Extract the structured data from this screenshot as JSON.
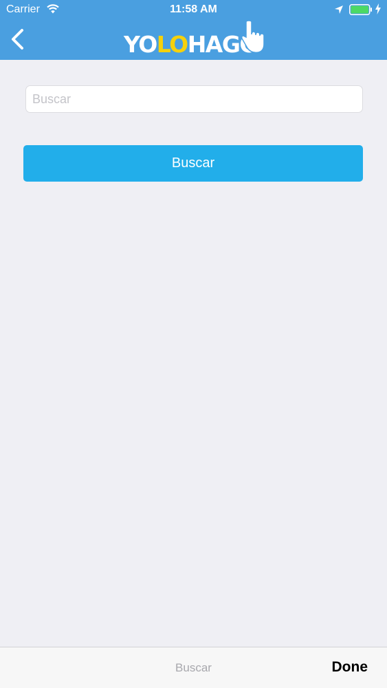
{
  "status_bar": {
    "carrier": "Carrier",
    "time": "11:58 AM"
  },
  "nav": {
    "logo": {
      "part1": "YO",
      "part2": "LO",
      "part3": "HAGO"
    },
    "back_icon": "chevron-left-icon"
  },
  "search": {
    "placeholder": "Buscar",
    "value": "",
    "button_label": "Buscar"
  },
  "keyboard_toolbar": {
    "title": "Buscar",
    "done_label": "Done"
  },
  "colors": {
    "nav_background": "#4a9fe0",
    "button_background": "#22aeea",
    "logo_accent": "#f5d10c",
    "page_background": "#efeff4"
  }
}
